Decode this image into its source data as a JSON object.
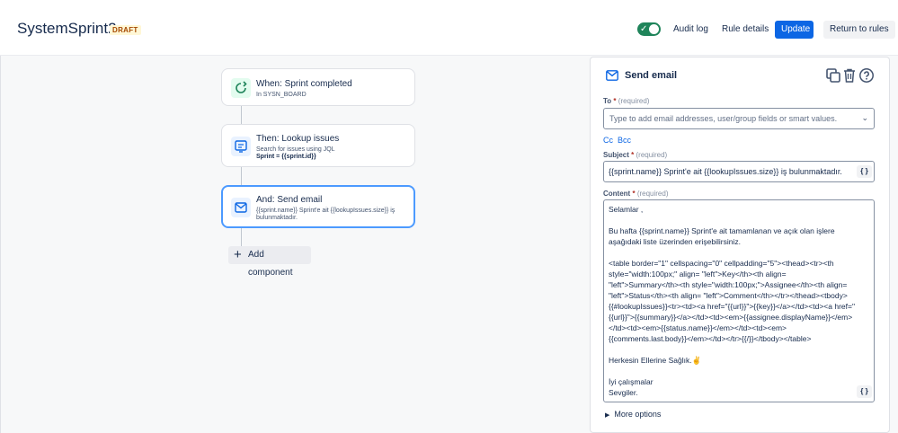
{
  "header": {
    "title": "SystemSprint2",
    "badge": "DRAFT",
    "audit_log": "Audit log",
    "rule_details": "Rule details",
    "update": "Update",
    "return_to_rules": "Return to rules",
    "accent": "#0c66e4"
  },
  "flow": {
    "trigger": {
      "title": "When: Sprint completed",
      "sub": "In SYSN_BOARD"
    },
    "lookup": {
      "title": "Then: Lookup issues",
      "sub1": "Search for issues using JQL",
      "sub2": "Sprint = {{sprint.id}}"
    },
    "email": {
      "title": "And: Send email",
      "sub1": "{{sprint.name}} Sprint'e ait {{lookupIssues.size}} iş",
      "sub2": "bulunmaktadır."
    },
    "add_component": "Add component"
  },
  "panel": {
    "title": "Send email",
    "to": {
      "label": "To",
      "req": "(required)",
      "placeholder": "Type to add email addresses, user/group fields or smart values."
    },
    "cc": "Cc",
    "bcc": "Bcc",
    "subject": {
      "label": "Subject",
      "req": "(required)",
      "value": "{{sprint.name}} Sprint'e ait {{lookupIssues.size}} iş bulunmaktadır."
    },
    "content": {
      "label": "Content",
      "req": "(required)",
      "lines": [
        "Selamlar ,",
        "",
        "Bu hafta {{sprint.name}} Sprint'e ait tamamlanan ve açık olan işlere",
        "aşağıdaki liste üzerinden erişebilirsiniz.",
        "",
        "<table border=\"1\" cellspacing=\"0\" cellpadding=\"5\"><thead><tr><th",
        "style=\"width:100px;\" align= \"left\">Key</th><th align=",
        "\"left\">Summary</th><th style=\"width:100px;\">Assignee</th><th align=",
        "\"left\">Status</th><th align= \"left\">Comment</th></tr></thead><tbody>",
        "{{#lookupIssues}}<tr><td><a href=\"{{url}}\">{{key}}</a></td><td><a href=\"",
        "{{url}}\">{{summary}}</a></td><td><em>{{assignee.displayName}}</em>",
        "</td><td><em>{{status.name}}</em></td><td><em>",
        "{{comments.last.body}}</em></td></tr>{{/}}</tbody></table>",
        "",
        "Herkesin Ellerine Sağlık.✌️",
        "",
        "İyi çalışmalar",
        "Sevgiler."
      ]
    },
    "smart_values": "{ }",
    "more_options": "More options"
  }
}
